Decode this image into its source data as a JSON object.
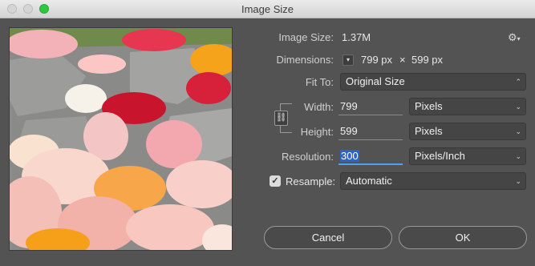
{
  "window": {
    "title": "Image Size"
  },
  "info": {
    "image_size_label": "Image Size:",
    "image_size_value": "1.37M",
    "dimensions_label": "Dimensions:",
    "dimensions_width": "799 px",
    "dimensions_sep": "×",
    "dimensions_height": "599 px"
  },
  "fit_to": {
    "label": "Fit To:",
    "value": "Original Size"
  },
  "width": {
    "label": "Width:",
    "value": "799",
    "unit": "Pixels"
  },
  "height": {
    "label": "Height:",
    "value": "599",
    "unit": "Pixels"
  },
  "resolution": {
    "label": "Resolution:",
    "value": "300",
    "unit": "Pixels/Inch"
  },
  "resample": {
    "label": "Resample:",
    "checked": true,
    "value": "Automatic"
  },
  "buttons": {
    "cancel": "Cancel",
    "ok": "OK"
  },
  "icons": {
    "gear": "gear-icon",
    "dimensions_menu": "chevron-down-icon",
    "link": "chain-link-icon",
    "select_arrow": "updown-arrow-icon"
  },
  "colors": {
    "dialog_bg": "#535353",
    "accent": "#4aa2ff",
    "selection": "#2e64c8",
    "maximize": "#2ec73f"
  }
}
